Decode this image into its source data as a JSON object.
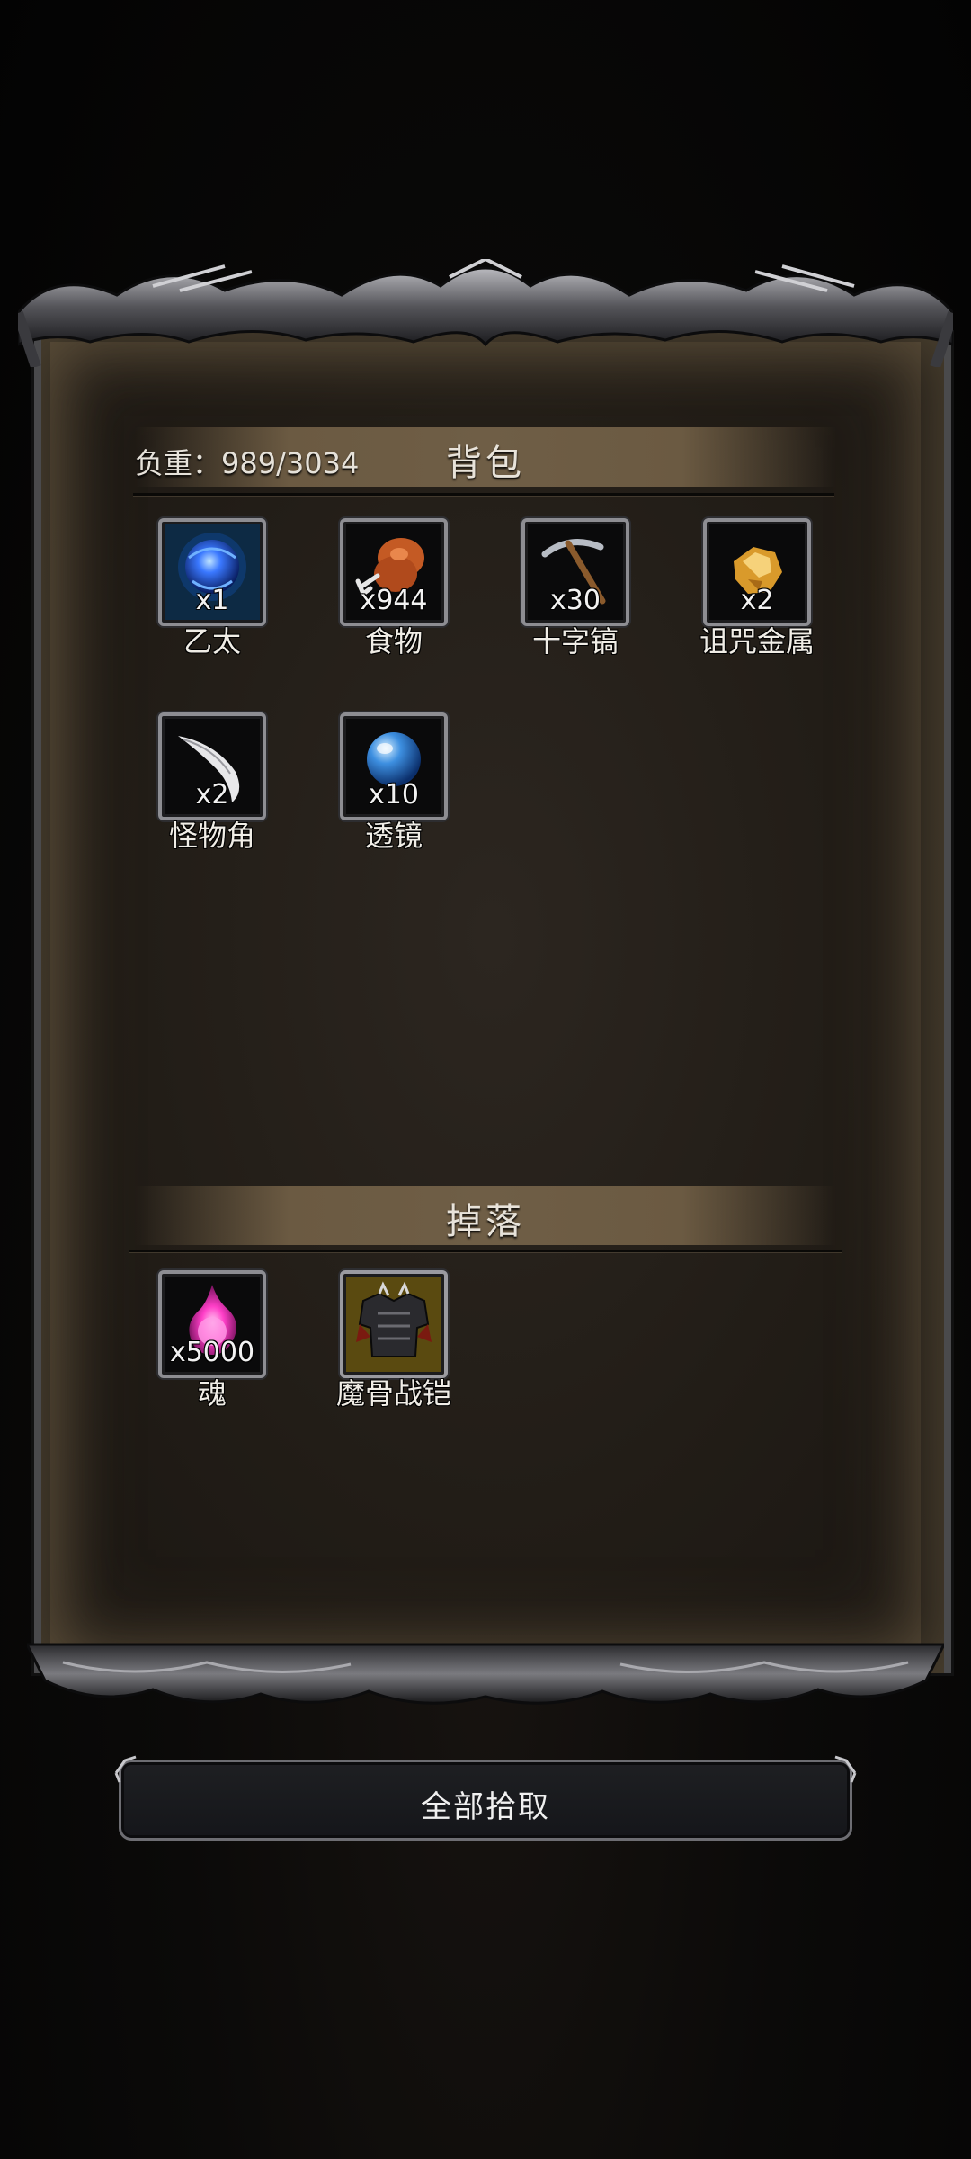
{
  "inventory": {
    "weight_label": "负重：989/3034",
    "title": "背包",
    "items": [
      {
        "name": "乙太",
        "qty": "x1",
        "icon": "ether-orb-icon"
      },
      {
        "name": "食物",
        "qty": "x944",
        "icon": "meat-icon"
      },
      {
        "name": "十字镐",
        "qty": "x30",
        "icon": "pickaxe-icon"
      },
      {
        "name": "诅咒金属",
        "qty": "x2",
        "icon": "gold-ore-icon"
      },
      {
        "name": "怪物角",
        "qty": "x2",
        "icon": "horn-icon"
      },
      {
        "name": "透镜",
        "qty": "x10",
        "icon": "lens-icon"
      }
    ]
  },
  "drops": {
    "title": "掉落",
    "items": [
      {
        "name": "魂",
        "qty": "x5000",
        "icon": "soul-flame-icon"
      },
      {
        "name": "魔骨战铠",
        "qty": "",
        "icon": "armor-icon"
      }
    ]
  },
  "actions": {
    "pick_all_label": "全部拾取"
  },
  "colors": {
    "panel": "#231e18",
    "header_bar": "#6b5a42",
    "frame_metal": "#8d8d92",
    "text": "#f0ede6"
  }
}
